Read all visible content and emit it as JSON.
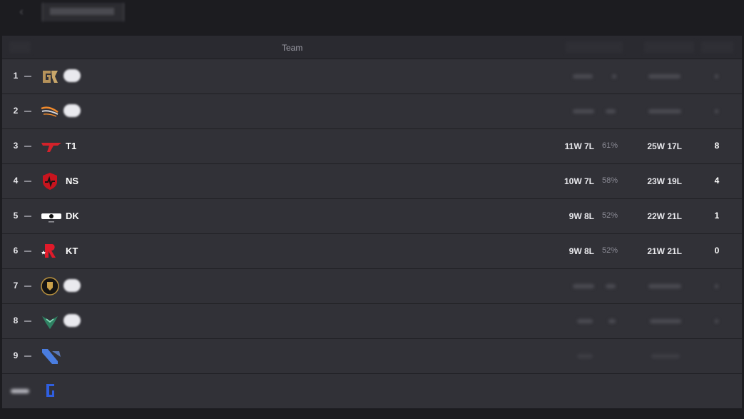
{
  "nav": {
    "back_icon": "back-arrow-icon"
  },
  "table": {
    "header": {
      "team_label": "Team"
    },
    "rows": [
      {
        "rank": "1",
        "team": "",
        "logo": "gen-g-logo-icon",
        "match": "",
        "winrate": "",
        "games": "",
        "points": "",
        "blurred": true
      },
      {
        "rank": "2",
        "team": "",
        "logo": "hanwha-logo-icon",
        "match": "",
        "winrate": "",
        "games": "",
        "points": "",
        "blurred": true
      },
      {
        "rank": "3",
        "team": "T1",
        "logo": "t1-logo-icon",
        "match": "11W 7L",
        "winrate": "61%",
        "games": "25W 17L",
        "points": "8",
        "blurred": false
      },
      {
        "rank": "4",
        "team": "NS",
        "logo": "ns-logo-icon",
        "match": "10W 7L",
        "winrate": "58%",
        "games": "23W 19L",
        "points": "4",
        "blurred": false
      },
      {
        "rank": "5",
        "team": "DK",
        "logo": "dk-logo-icon",
        "match": "9W 8L",
        "winrate": "52%",
        "games": "22W 21L",
        "points": "1",
        "blurred": false
      },
      {
        "rank": "6",
        "team": "KT",
        "logo": "kt-logo-icon",
        "match": "9W 8L",
        "winrate": "52%",
        "games": "21W 21L",
        "points": "0",
        "blurred": false
      },
      {
        "rank": "7",
        "team": "",
        "logo": "lion-crest-logo-icon",
        "match": "",
        "winrate": "",
        "games": "",
        "points": "",
        "blurred": true
      },
      {
        "rank": "8",
        "team": "",
        "logo": "green-bird-logo-icon",
        "match": "",
        "winrate": "",
        "games": "",
        "points": "",
        "blurred": true
      },
      {
        "rank": "9",
        "team": "",
        "logo": "blue-diagonal-logo-icon",
        "match": "",
        "winrate": "",
        "games": "",
        "points": "",
        "blurred": true
      },
      {
        "rank": "",
        "team": "",
        "logo": "blue-shield-logo-icon",
        "match": "",
        "winrate": "",
        "games": "",
        "points": "",
        "blurred": true
      }
    ]
  },
  "colors": {
    "page_bg": "#1c1c20",
    "row_bg": "#313137",
    "header_bg": "#2a2a30",
    "text_primary": "#e8e8ec",
    "text_muted": "#8a8a94",
    "t1_red": "#d3222a",
    "gen_gold": "#b5925a",
    "dk_white": "#ffffff"
  }
}
